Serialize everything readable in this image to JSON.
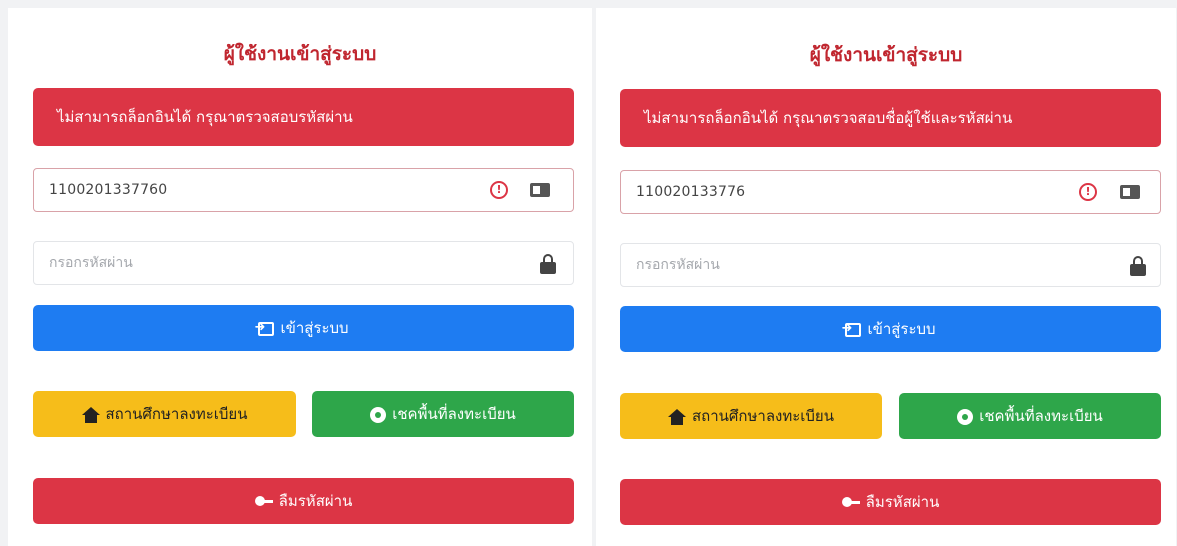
{
  "panels": [
    {
      "title": "ผู้ใช้งานเข้าสู่ระบบ",
      "alert": "ไม่สามารถล็อกอินได้ กรุณาตรวจสอบรหัสผ่าน",
      "username_value": "1100201337760",
      "password_placeholder": "กรอกรหัสผ่าน",
      "login_label": "เข้าสู่ระบบ",
      "status_label": "สถานศึกษาลงทะเบียน",
      "check_label": "เชคพื้นที่ลงทะเบียน",
      "forgot_label": "ลืมรหัสผ่าน"
    },
    {
      "title": "ผู้ใช้งานเข้าสู่ระบบ",
      "alert": "ไม่สามารถล็อกอินได้ กรุณาตรวจสอบชื่อผู้ใช้และรหัสผ่าน",
      "username_value": "110020133776",
      "password_placeholder": "กรอกรหัสผ่าน",
      "login_label": "เข้าสู่ระบบ",
      "status_label": "สถานศึกษาลงทะเบียน",
      "check_label": "เชคพื้นที่ลงทะเบียน",
      "forgot_label": "ลืมรหัสผ่าน"
    }
  ],
  "icons": {
    "warning": "exclamation-circle-icon",
    "id_card": "id-card-icon",
    "lock": "lock-icon",
    "sign_in": "sign-in-icon",
    "school": "school-icon",
    "search_location": "search-location-icon",
    "key": "key-icon"
  },
  "colors": {
    "title": "#c0262f",
    "danger": "#dc3545",
    "primary": "#1e7cf2",
    "warning": "#f6bd1a",
    "success": "#2ea64a"
  }
}
